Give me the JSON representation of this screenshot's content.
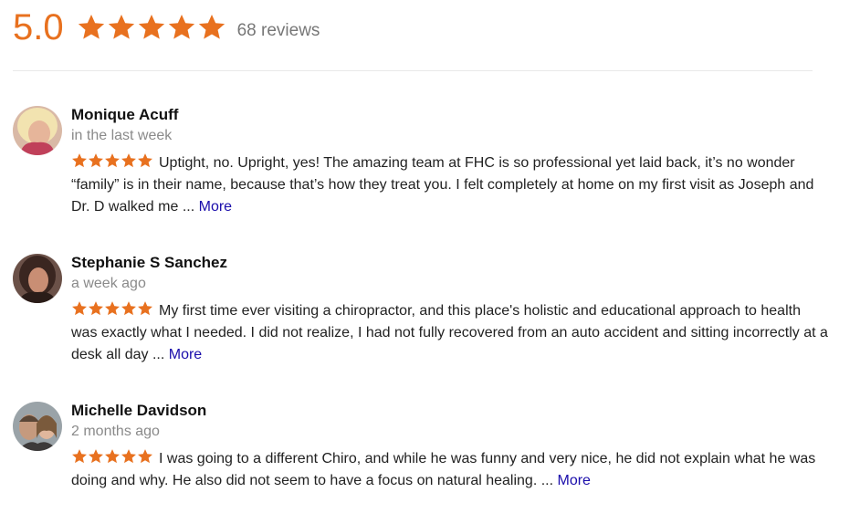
{
  "rating": {
    "score": "5.0",
    "stars": 5,
    "reviews_count": "68 reviews",
    "star_color": "#e8711f"
  },
  "reviews": [
    {
      "name": "Monique Acuff",
      "time": "in the last week",
      "stars": 5,
      "text": "Uptight, no.  Upright, yes!  The amazing team at FHC is so professional yet laid back, it’s no wonder “family” is in their name, because that’s how they treat you. I felt completely at home on my first visit as Joseph and Dr. D walked me ...",
      "more_label": "More"
    },
    {
      "name": "Stephanie S Sanchez",
      "time": "a week ago",
      "stars": 5,
      "text": "My first time ever visiting a chiropractor, and this place's holistic and educational approach to health was exactly what I needed. I did not realize, I had not fully recovered from an auto accident and sitting incorrectly at a desk all day ...",
      "more_label": "More"
    },
    {
      "name": "Michelle Davidson",
      "time": "2 months ago",
      "stars": 5,
      "text": "I was going to a different Chiro, and while he was funny and very nice, he did not explain what he was doing and why. He also did not seem to have a focus on natural healing. ...",
      "more_label": "More"
    }
  ]
}
